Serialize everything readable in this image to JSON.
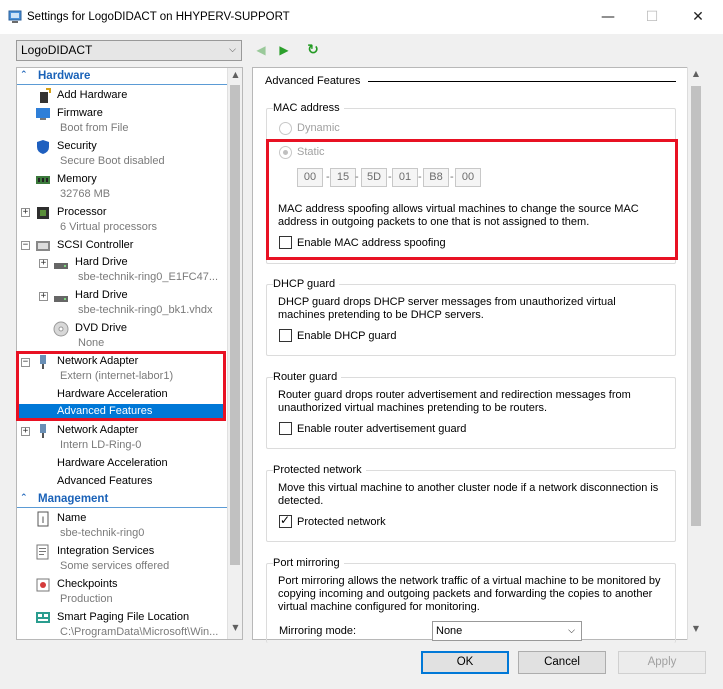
{
  "window": {
    "title": "Settings for LogoDIDACT on HHYPERV-SUPPORT",
    "minimize": "—",
    "maximize": "☐",
    "close": "✕"
  },
  "toolbar": {
    "vm_selected": "LogoDIDACT",
    "back_icon": "◀",
    "forward_icon": "▶",
    "refresh_icon": "↻"
  },
  "sidebar": {
    "hardware_label": "Hardware",
    "management_label": "Management",
    "items": [
      {
        "name": "Add Hardware",
        "sub": ""
      },
      {
        "name": "Firmware",
        "sub": "Boot from File"
      },
      {
        "name": "Security",
        "sub": "Secure Boot disabled"
      },
      {
        "name": "Memory",
        "sub": "32768 MB"
      },
      {
        "name": "Processor",
        "sub": "6 Virtual processors"
      },
      {
        "name": "SCSI Controller",
        "sub": ""
      },
      {
        "name": "Hard Drive",
        "sub": "sbe-technik-ring0_E1FC47..."
      },
      {
        "name": "Hard Drive",
        "sub": "sbe-technik-ring0_bk1.vhdx"
      },
      {
        "name": "DVD Drive",
        "sub": "None"
      },
      {
        "name": "Network Adapter",
        "sub": "Extern (internet-labor1)"
      },
      {
        "name": "Hardware Acceleration",
        "sub": ""
      },
      {
        "name": "Advanced Features",
        "sub": ""
      },
      {
        "name": "Network Adapter",
        "sub": "Intern LD-Ring-0"
      },
      {
        "name": "Hardware Acceleration",
        "sub": ""
      },
      {
        "name": "Advanced Features",
        "sub": ""
      }
    ],
    "management_items": [
      {
        "name": "Name",
        "sub": "sbe-technik-ring0"
      },
      {
        "name": "Integration Services",
        "sub": "Some services offered"
      },
      {
        "name": "Checkpoints",
        "sub": "Production"
      },
      {
        "name": "Smart Paging File Location",
        "sub": "C:\\ProgramData\\Microsoft\\Win..."
      }
    ]
  },
  "main": {
    "title": "Advanced Features",
    "mac": {
      "group_title": "MAC address",
      "dynamic_label": "Dynamic",
      "static_label": "Static",
      "octets": [
        "00",
        "15",
        "5D",
        "01",
        "B8",
        "00"
      ],
      "dash": "-",
      "spoof_text": "MAC address spoofing allows virtual machines to change the source MAC address in outgoing packets to one that is not assigned to them.",
      "spoof_label": "Enable MAC address spoofing"
    },
    "dhcp": {
      "title": "DHCP guard",
      "text": "DHCP guard drops DHCP server messages from unauthorized virtual machines pretending to be DHCP servers.",
      "label": "Enable DHCP guard"
    },
    "router": {
      "title": "Router guard",
      "text": "Router guard drops router advertisement and redirection messages from unauthorized virtual machines pretending to be routers.",
      "label": "Enable router advertisement guard"
    },
    "protected": {
      "title": "Protected network",
      "text": "Move this virtual machine to another cluster node if a network disconnection is detected.",
      "label": "Protected network",
      "checked": true
    },
    "mirroring": {
      "title": "Port mirroring",
      "text": "Port mirroring allows the network traffic of a virtual machine to be monitored by copying incoming and outgoing packets and forwarding the copies to another virtual machine configured for monitoring.",
      "mode_label": "Mirroring mode:",
      "mode_value": "None"
    }
  },
  "buttons": {
    "ok": "OK",
    "cancel": "Cancel",
    "apply": "Apply"
  },
  "scroll_arrows": {
    "up": "▲",
    "down": "▼"
  },
  "select_arrow": "⌵",
  "colors": {
    "accent": "#0078d7",
    "highlight_red": "#e81123",
    "section_blue": "#1a62b8"
  }
}
